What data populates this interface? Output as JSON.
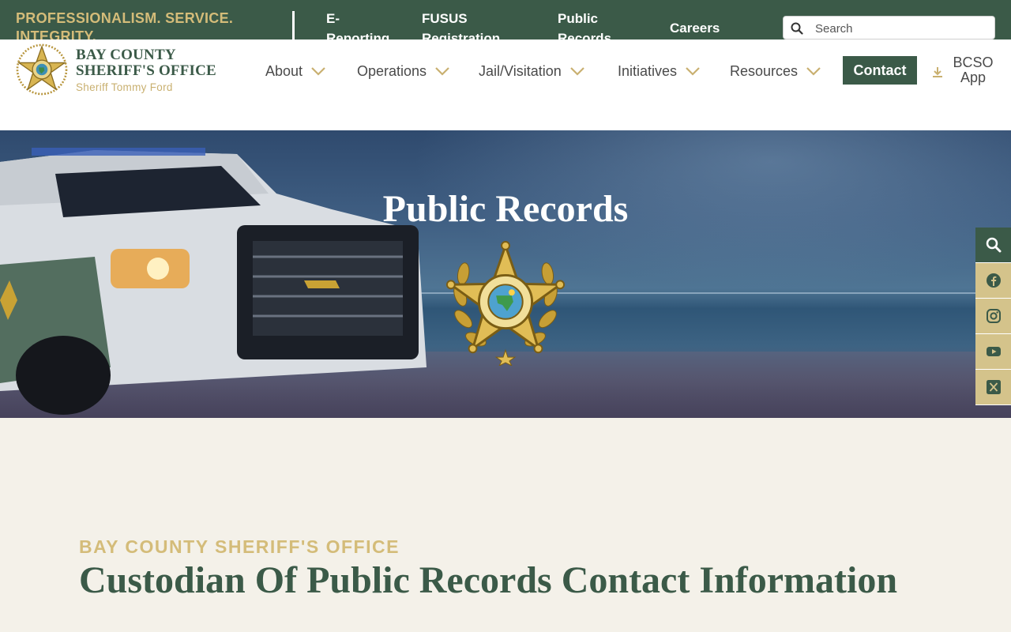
{
  "topbar": {
    "motto": "PROFESSIONALISM. SERVICE. INTEGRITY.",
    "links": [
      {
        "label": "E-Reporting"
      },
      {
        "label": "FUSUS Registration"
      },
      {
        "label": "Public Records"
      },
      {
        "label": "Careers"
      }
    ],
    "search": {
      "placeholder": "Search",
      "icon": "search-icon"
    }
  },
  "header": {
    "brand": {
      "line1": "BAY COUNTY",
      "line2": "SHERIFF'S OFFICE",
      "line3": "Sheriff Tommy Ford",
      "logo": "sheriff-badge-logo"
    },
    "nav": [
      {
        "label": "About",
        "icon": "chevron-down-icon"
      },
      {
        "label": "Operations",
        "icon": "chevron-down-icon"
      },
      {
        "label": "Jail/Visitation",
        "icon": "chevron-down-icon"
      },
      {
        "label": "Initiatives",
        "icon": "chevron-down-icon"
      },
      {
        "label": "Resources",
        "icon": "chevron-down-icon"
      }
    ],
    "contact_label": "Contact",
    "app": {
      "line1": "BCSO",
      "line2": "App",
      "icon": "download-icon"
    }
  },
  "hero": {
    "title": "Public Records",
    "badge": "sheriff-badge-emblem"
  },
  "rail": [
    "search-icon",
    "facebook-icon",
    "instagram-icon",
    "youtube-icon",
    "x-twitter-icon"
  ],
  "content": {
    "eyebrow": "BAY COUNTY SHERIFF'S OFFICE",
    "title": "Custodian Of Public Records Contact Information"
  },
  "colors": {
    "primary_green": "#3b5a48",
    "gold": "#d4bc79",
    "cream": "#f4f1e9",
    "rail_gold": "#d4c38b"
  }
}
